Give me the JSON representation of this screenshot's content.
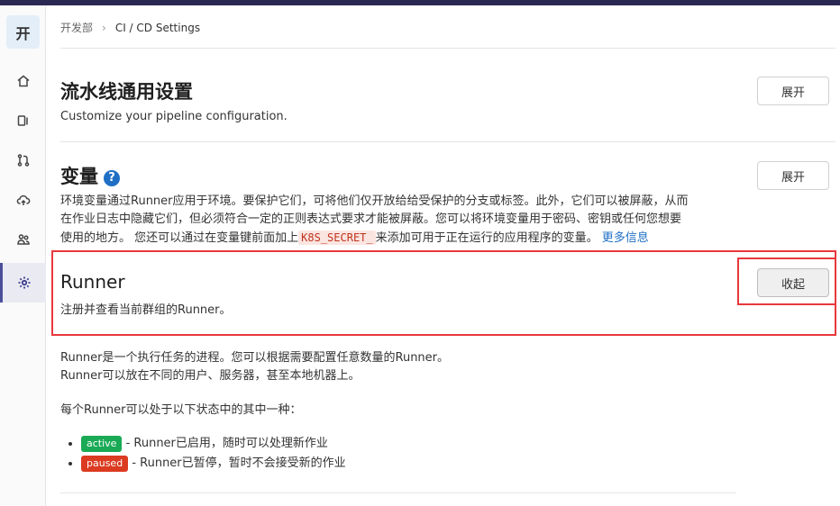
{
  "sidebar": {
    "avatar_letter": "开",
    "items": [
      {
        "name": "home",
        "icon": "home-icon"
      },
      {
        "name": "overview",
        "icon": "issues-icon"
      },
      {
        "name": "merge-requests",
        "icon": "merge-request-icon"
      },
      {
        "name": "deploy",
        "icon": "cloud-icon"
      },
      {
        "name": "members",
        "icon": "users-icon"
      },
      {
        "name": "settings",
        "icon": "gear-icon",
        "active": true
      }
    ]
  },
  "breadcrumb": {
    "parent": "开发部",
    "current": "CI / CD Settings"
  },
  "sections": {
    "pipeline": {
      "title": "流水线通用设置",
      "description": "Customize your pipeline configuration.",
      "button": "展开"
    },
    "variables": {
      "title": "变量",
      "help_icon": "?",
      "description_line1": "环境变量通过Runner应用于环境。要保护它们，可将他们仅开放给给受保护的分支或标签。此外，它们可以被屏蔽，从而",
      "description_line2": "在作业日志中隐藏它们，但必须符合一定的正则表达式要求才能被屏蔽。您可以将环境变量用于密码、密钥或任何您想要",
      "description_line3_a": "使用的地方。 您还可以通过在变量键前面加上",
      "code": "K8S_SECRET_",
      "description_line3_b": "来添加可用于正在运行的应用程序的变量。",
      "link": "更多信息",
      "button": "展开"
    },
    "runner": {
      "title": "Runner",
      "description": "注册并查看当前群组的Runner。",
      "button": "收起",
      "body_line1": "Runner是一个执行任务的进程。您可以根据需要配置任意数量的Runner。",
      "body_line2": "Runner可以放在不同的用户、服务器，甚至本地机器上。",
      "states_intro": "每个Runner可以处于以下状态中的其中一种：",
      "states": [
        {
          "badge": "active",
          "text": " - Runner已启用，随时可以处理新作业"
        },
        {
          "badge": "paused",
          "text": " - Runner已暂停，暂时不会接受新的作业"
        }
      ]
    }
  },
  "colors": {
    "topbar": "#2b2753",
    "link": "#1f6fc5",
    "highlight": "#e8383d",
    "active_badge": "#1aaa55",
    "paused_badge": "#db3b21"
  }
}
